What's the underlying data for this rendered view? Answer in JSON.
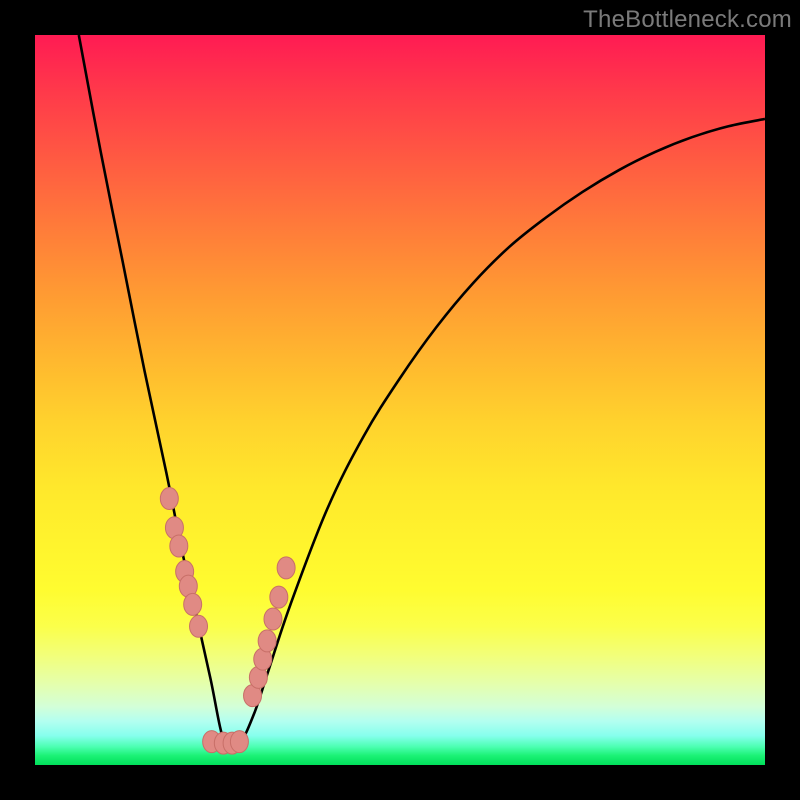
{
  "watermark": "TheBottleneck.com",
  "colors": {
    "frame": "#000000",
    "curve": "#000000",
    "marker_fill": "#e08a84",
    "marker_stroke": "#c86f68",
    "gradient_top": "#ff1b53",
    "gradient_bottom": "#00e05a"
  },
  "chart_data": {
    "type": "line",
    "title": "",
    "xlabel": "",
    "ylabel": "",
    "xlim": [
      0,
      100
    ],
    "ylim": [
      0,
      100
    ],
    "grid": false,
    "legend": false,
    "comment": "V-shaped bottleneck curve. x is normalized horizontal position (0=left edge of plot, 100=right). y is normalized vertical position (0=bottom green band, 100=top red band). Minimum (sweet spot) near x≈26.",
    "series": [
      {
        "name": "bottleneck-curve",
        "x": [
          6,
          9,
          12,
          15,
          18,
          20,
          22,
          24,
          26,
          28,
          30,
          32,
          35,
          40,
          45,
          50,
          55,
          60,
          65,
          70,
          75,
          80,
          85,
          90,
          95,
          100
        ],
        "y": [
          100,
          84,
          69,
          54,
          40,
          30,
          21,
          12,
          3,
          3,
          7,
          13,
          22,
          35,
          45,
          53,
          60,
          66,
          71,
          75,
          78.5,
          81.5,
          84,
          86,
          87.5,
          88.5
        ]
      }
    ],
    "markers": {
      "name": "highlighted-points",
      "comment": "Salmon-colored dots clustered along the steep walls and floor of the V.",
      "x": [
        18.4,
        19.1,
        19.7,
        20.5,
        21.0,
        21.6,
        22.4,
        24.2,
        25.8,
        27.0,
        28.0,
        29.8,
        30.6,
        31.2,
        31.8,
        32.6,
        33.4,
        34.4
      ],
      "y": [
        36.5,
        32.5,
        30.0,
        26.5,
        24.5,
        22.0,
        19.0,
        3.2,
        3.0,
        3.0,
        3.2,
        9.5,
        12.0,
        14.5,
        17.0,
        20.0,
        23.0,
        27.0
      ]
    }
  }
}
